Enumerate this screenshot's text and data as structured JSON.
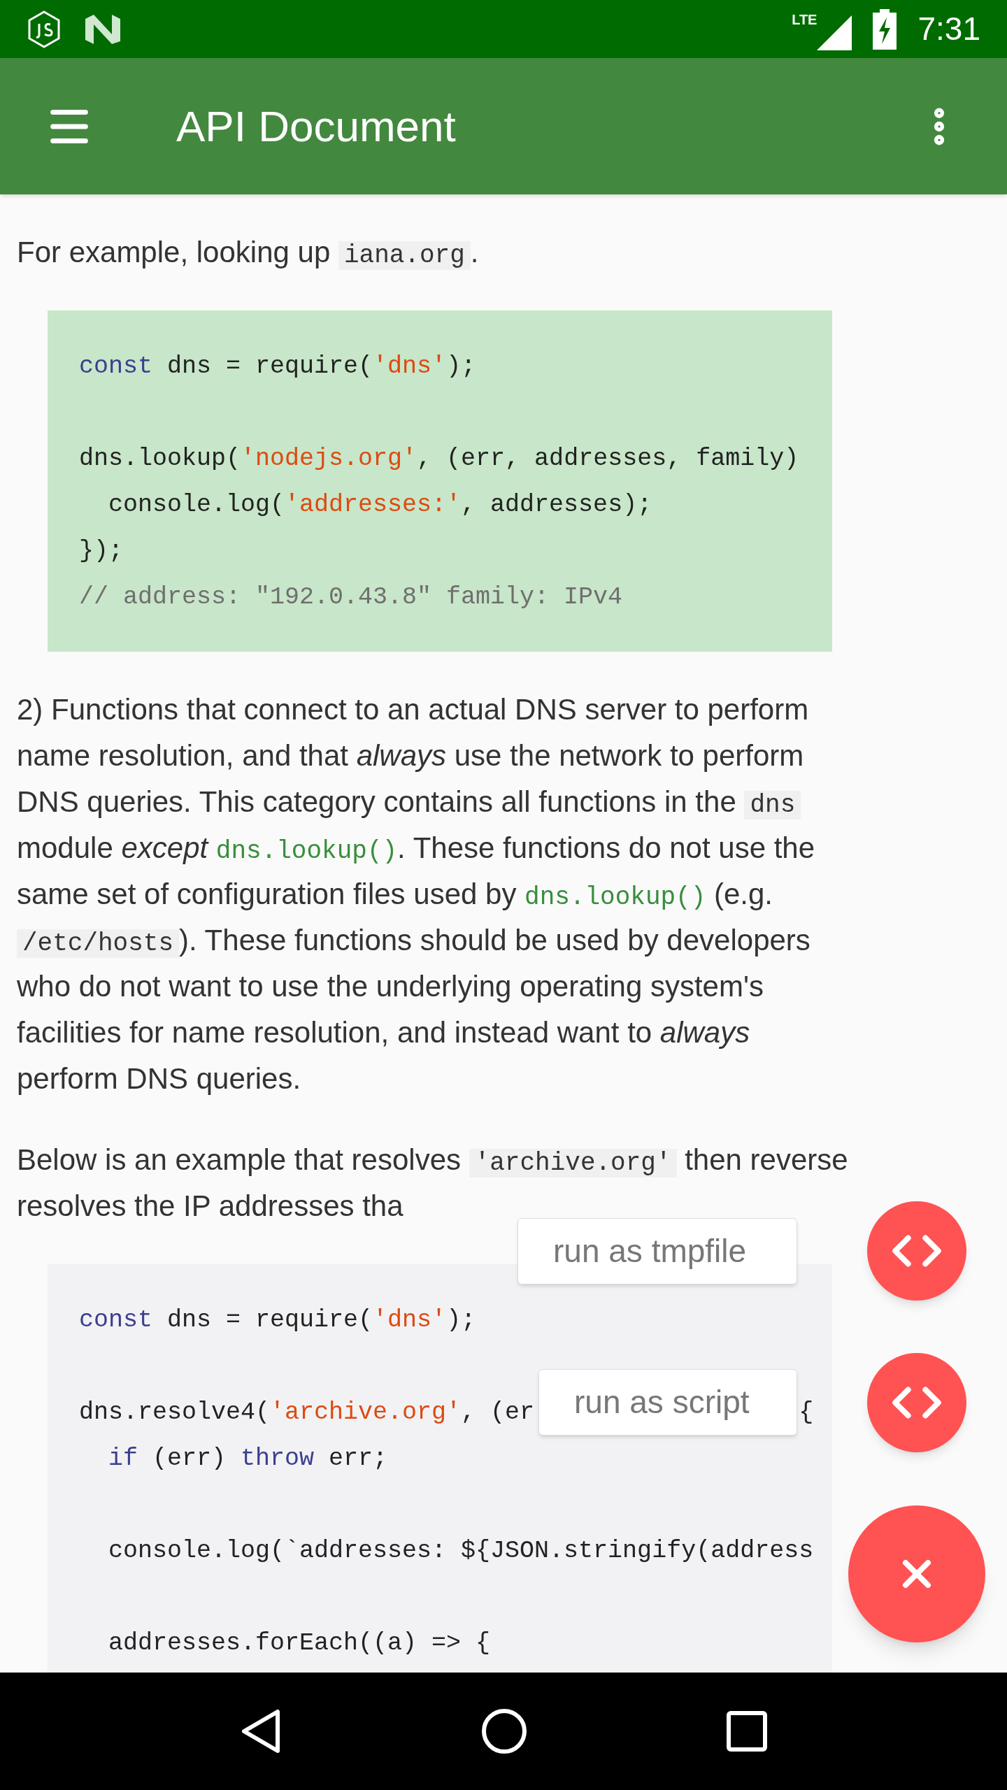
{
  "status_bar": {
    "network": "LTE",
    "time": "7:31"
  },
  "app_bar": {
    "title": "API Document"
  },
  "content": [
    {
      "kind": "paragraph",
      "segments": [
        {
          "kind": "text",
          "text": "For example, looking up "
        },
        {
          "kind": "code",
          "text": "iana.org"
        },
        {
          "kind": "text",
          "text": "."
        }
      ]
    },
    {
      "kind": "code_block",
      "color": "#c8e6c9",
      "lines": [
        {
          "kind": "code",
          "tokens": [
            {
              "kind": "keyword",
              "text": "const"
            },
            {
              "kind": "plain",
              "text": " dns = require("
            },
            {
              "kind": "string",
              "text": "'dns'"
            },
            {
              "kind": "plain",
              "text": ");"
            }
          ]
        },
        {
          "kind": "blank"
        },
        {
          "kind": "code",
          "tokens": [
            {
              "kind": "plain",
              "text": "dns.lookup("
            },
            {
              "kind": "string",
              "text": "'nodejs.org'"
            },
            {
              "kind": "plain",
              "text": ", (err, addresses, family)"
            }
          ]
        },
        {
          "kind": "code",
          "indented": true,
          "tokens": [
            {
              "kind": "plain",
              "text": "console.log("
            },
            {
              "kind": "string",
              "text": "'addresses:'"
            },
            {
              "kind": "plain",
              "text": ", addresses);"
            }
          ]
        },
        {
          "kind": "code",
          "tokens": [
            {
              "kind": "plain",
              "text": "});"
            }
          ]
        },
        {
          "kind": "code",
          "tokens": [
            {
              "kind": "comment",
              "text": "// address: \"192.0.43.8\" family: IPv4"
            }
          ]
        }
      ]
    },
    {
      "kind": "paragraph",
      "segments": [
        {
          "kind": "text",
          "text": "2) Functions that connect to an actual DNS server to perform name resolution, and that *always* use the network to perform DNS queries. This category contains all functions in the "
        },
        {
          "kind": "code",
          "text": "dns"
        },
        {
          "kind": "text",
          "text": " module *except* "
        },
        {
          "kind": "link",
          "text": "dns.lookup()"
        },
        {
          "kind": "text",
          "text": ". These functions do not use the same set of configuration files used by "
        },
        {
          "kind": "link",
          "text": "dns.lookup()"
        },
        {
          "kind": "text",
          "text": " (e.g. "
        },
        {
          "kind": "code",
          "text": "/etc/hosts"
        },
        {
          "kind": "text",
          "text": "). These functions should be used by developers who do not want to use the underlying operating system's facilities for name resolution, and instead want to *always* perform DNS queries."
        }
      ]
    },
    {
      "kind": "paragraph",
      "segments": [
        {
          "kind": "text",
          "text": "Below is an example that resolves "
        },
        {
          "kind": "code",
          "text": "'archive.org'"
        },
        {
          "kind": "text",
          "text": " then reverse resolves the IP addresses tha"
        }
      ]
    },
    {
      "kind": "code_block",
      "color": "#f2f2f4",
      "lines": [
        {
          "kind": "code",
          "tokens": [
            {
              "kind": "keyword",
              "text": "const"
            },
            {
              "kind": "plain",
              "text": " dns = require("
            },
            {
              "kind": "string",
              "text": "'dns'"
            },
            {
              "kind": "plain",
              "text": ");"
            }
          ]
        },
        {
          "kind": "blank"
        },
        {
          "kind": "code",
          "tokens": [
            {
              "kind": "plain",
              "text": "dns.resolve4("
            },
            {
              "kind": "string",
              "text": "'archive.org'"
            },
            {
              "kind": "plain",
              "text": ", (er"
            },
            {
              "kind": "tail",
              "text": "{"
            }
          ]
        },
        {
          "kind": "code",
          "indented": true,
          "tokens": [
            {
              "kind": "keyword",
              "text": "if"
            },
            {
              "kind": "plain",
              "text": " (err) "
            },
            {
              "kind": "keyword",
              "text": "throw"
            },
            {
              "kind": "plain",
              "text": " err;"
            }
          ]
        },
        {
          "kind": "blank"
        },
        {
          "kind": "code",
          "indented": true,
          "tokens": [
            {
              "kind": "plain",
              "text": "console.log(`addresses: ${JSON.stringify(address"
            }
          ]
        },
        {
          "kind": "blank"
        },
        {
          "kind": "code",
          "indented": true,
          "tokens": [
            {
              "kind": "plain",
              "text": "addresses.forEach((a) => {"
            }
          ]
        }
      ]
    }
  ],
  "speed_dial": {
    "open": true,
    "actions": [
      {
        "label": "run as tmpfile"
      },
      {
        "label": "run as script"
      }
    ]
  }
}
